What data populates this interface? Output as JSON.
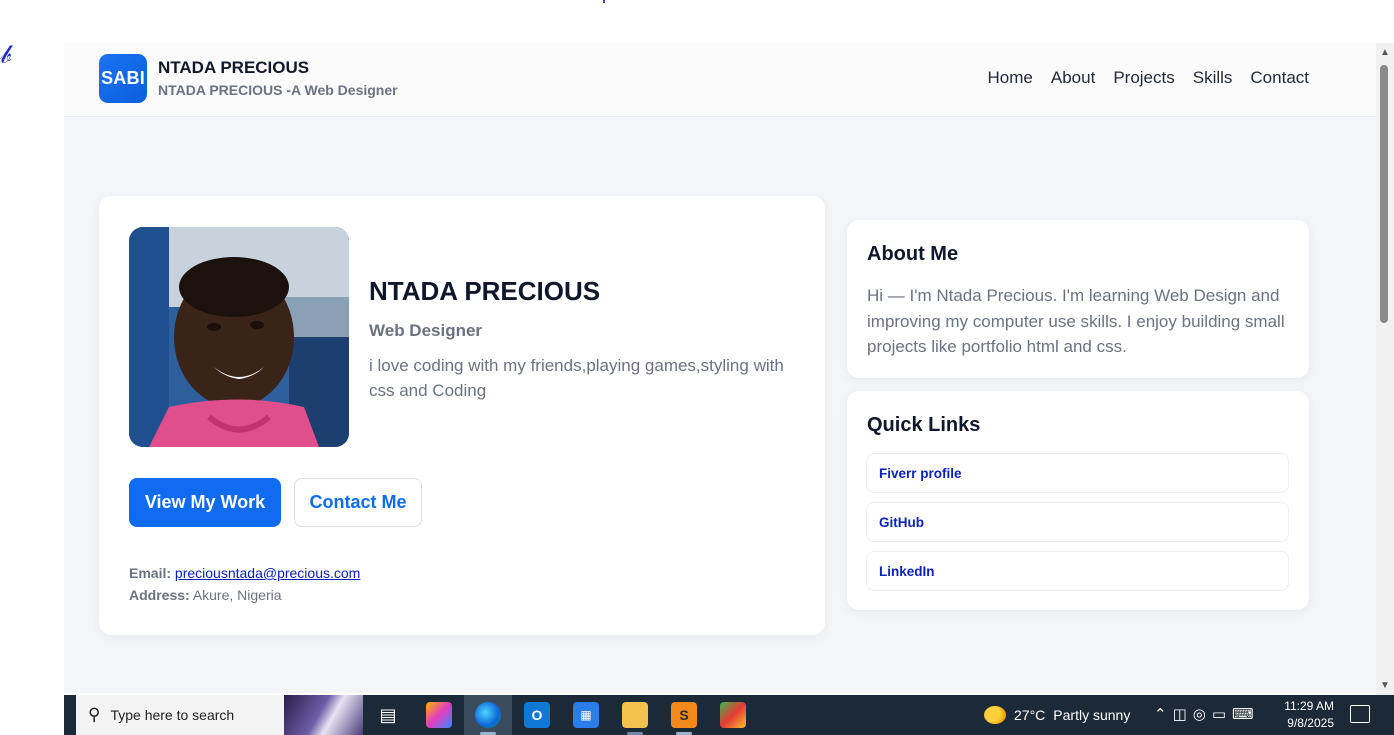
{
  "header": {
    "logo_text": "SABI",
    "brand_title": "NTADA PRECIOUS",
    "brand_subtitle": "NTADA PRECIOUS -A Web Designer",
    "nav": [
      "Home",
      "About",
      "Projects",
      "Skills",
      "Contact"
    ]
  },
  "profile": {
    "name": "NTADA PRECIOUS",
    "role": "Web Designer",
    "bio": "i love coding with my friends,playing games,styling with css and Coding",
    "primary_button": "View My Work",
    "secondary_button": "Contact Me",
    "email_label": "Email:",
    "email": "preciousntada@precious.com",
    "address_label": "Address:",
    "address": "Akure, Nigeria"
  },
  "about": {
    "title": "About Me",
    "text": "Hi — I'm Ntada Precious. I'm learning Web Design and improving my computer use skills. I enjoy building small projects like portfolio html and css."
  },
  "quick_links": {
    "title": "Quick Links",
    "items": [
      "Fiverr profile",
      "GitHub",
      "LinkedIn"
    ]
  },
  "taskbar": {
    "search_placeholder": "Type here to search",
    "weather_temp": "27°C",
    "weather_text": "Partly sunny",
    "time": "11:29 AM",
    "date": "9/8/2025"
  },
  "colors": {
    "primary": "#0f6cf0",
    "link": "#0b21b8",
    "heading": "#0f172a",
    "muted": "#6b7280",
    "background": "#f3f5f9",
    "taskbar": "#1c2936"
  }
}
